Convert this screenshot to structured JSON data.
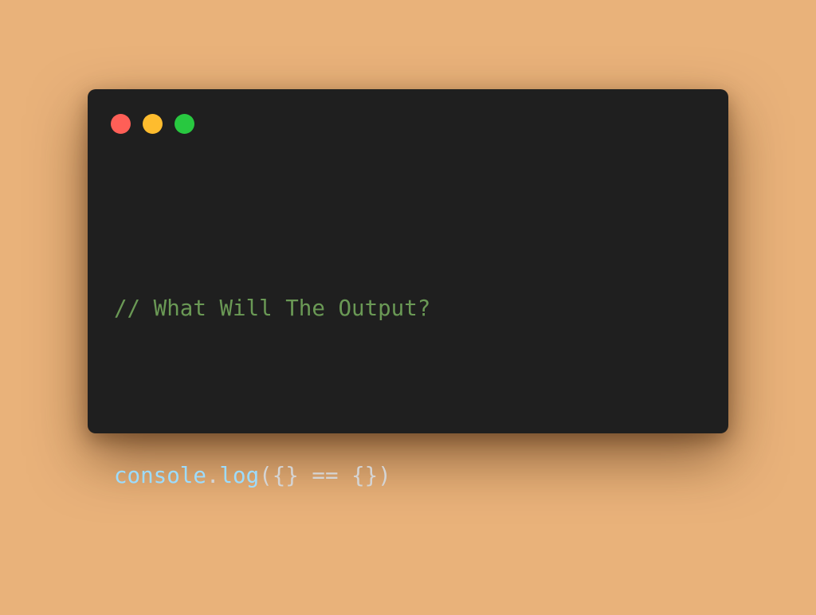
{
  "window": {
    "colors": {
      "page_background": "#E9B27A",
      "editor_background": "#1F1F1F",
      "close_dot": "#FF5F57",
      "minimize_dot": "#FEBC2E",
      "maximize_dot": "#28C840",
      "comment": "#6A9955",
      "identifier": "#9CDCFE",
      "text": "#D4D4D4"
    }
  },
  "code": {
    "comment": "// What Will The Output?",
    "object": "console",
    "dot": ".",
    "method": "log",
    "open_paren": "(",
    "left_operand": "{}",
    "operator": "==",
    "right_operand": "{}",
    "close_paren": ")"
  }
}
